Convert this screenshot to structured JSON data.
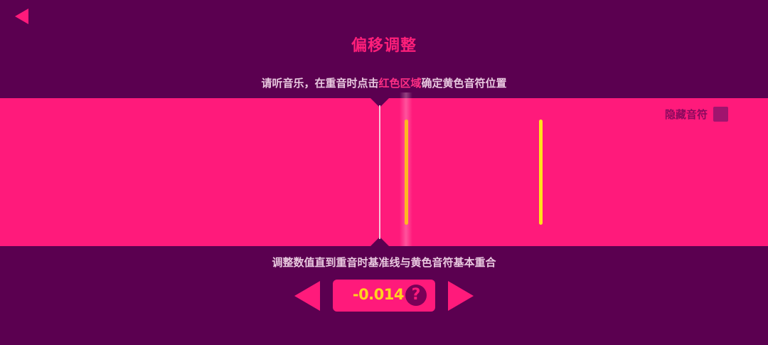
{
  "header": {
    "back_icon": "back-triangle-icon",
    "title": "偏移调整"
  },
  "instruction": {
    "before": "请听音乐，在重音时点击",
    "highlight": "红色区域",
    "after": "确定黄色音符位置"
  },
  "track": {
    "hide_notes_label": "隐藏音符",
    "hide_notes_checked": false
  },
  "hint": "调整数值直到重音时基准线与黄色音符基本重合",
  "offset": {
    "value": "-0.014",
    "help_icon": "question-mark-icon",
    "help_glyph": "?",
    "decrease_icon": "triangle-left-icon",
    "increase_icon": "triangle-right-icon"
  },
  "colors": {
    "background": "#5b0050",
    "accent": "#ff1a7b",
    "note_orange": "#ffb820",
    "note_yellow": "#ffe21a",
    "value_text": "#ffd21f"
  }
}
